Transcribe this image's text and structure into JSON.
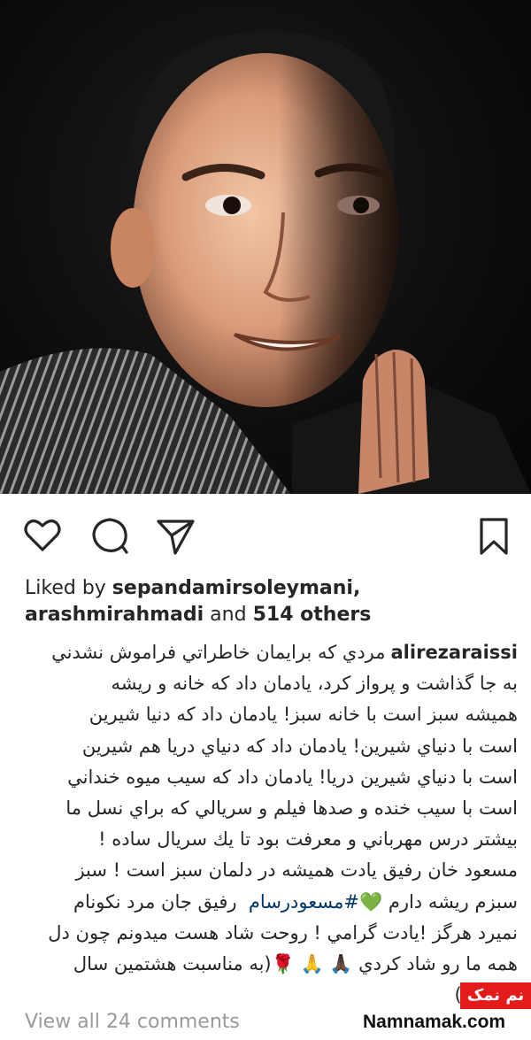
{
  "post": {
    "liked_by_prefix": "Liked by ",
    "liked_by_user1": "sepandamirsoleymani,",
    "liked_by_user2": "arashmirahmadi",
    "liked_by_and": " and ",
    "liked_by_others": "514 others",
    "username": "alirezaraissi",
    "caption_lines": [
      "مردي كه برايمان خاطراتي فراموش نشدني",
      "به جا گذاشت و پرواز كرد، يادمان داد كه خانه و ريشه",
      "هميشه سبز است با خانه سبز! يادمان داد كه دنيا شيرين",
      "است با دنياي شيرين! يادمان داد كه دنياي دريا هم شيرين",
      "است با دنياي شيرين دريا! يادمان داد كه سيب ميوه خنداني",
      "است با سيب خنده و صدها فيلم و سريالي كه براي نسل ما",
      "بيشتر درس مهرباني و معرفت بود تا يك سريال ساده !",
      "مسعود خان رفيق يادت هميشه در دلمان سبز است ! سبز",
      "سبزم ريشه دارم",
      "#مسعودرسام",
      "رفيق جان مرد نكونام",
      "نميرد هرگز !يادت گرامي ! روحت شاد هست ميدونم چون دل",
      "همه ما رو شاد كردي",
      "(به مناسبت هشتمين سال",
      "پروازت)"
    ],
    "emojis": {
      "green_heart": "💚",
      "pray_dark": "🙏🏿",
      "pray_light": "🙏",
      "rose": "🌹"
    },
    "view_all_comments": "View all 24 comments"
  },
  "icons": {
    "like": "heart-icon",
    "comment": "comment-icon",
    "share": "paper-plane-icon",
    "save": "bookmark-icon"
  },
  "watermark": {
    "badge": "نم نمک",
    "site": "Namnamak.com"
  },
  "colors": {
    "text": "#262626",
    "muted": "#9a9a9a",
    "hashtag": "#003569",
    "watermark_red": "#e31b1b"
  }
}
